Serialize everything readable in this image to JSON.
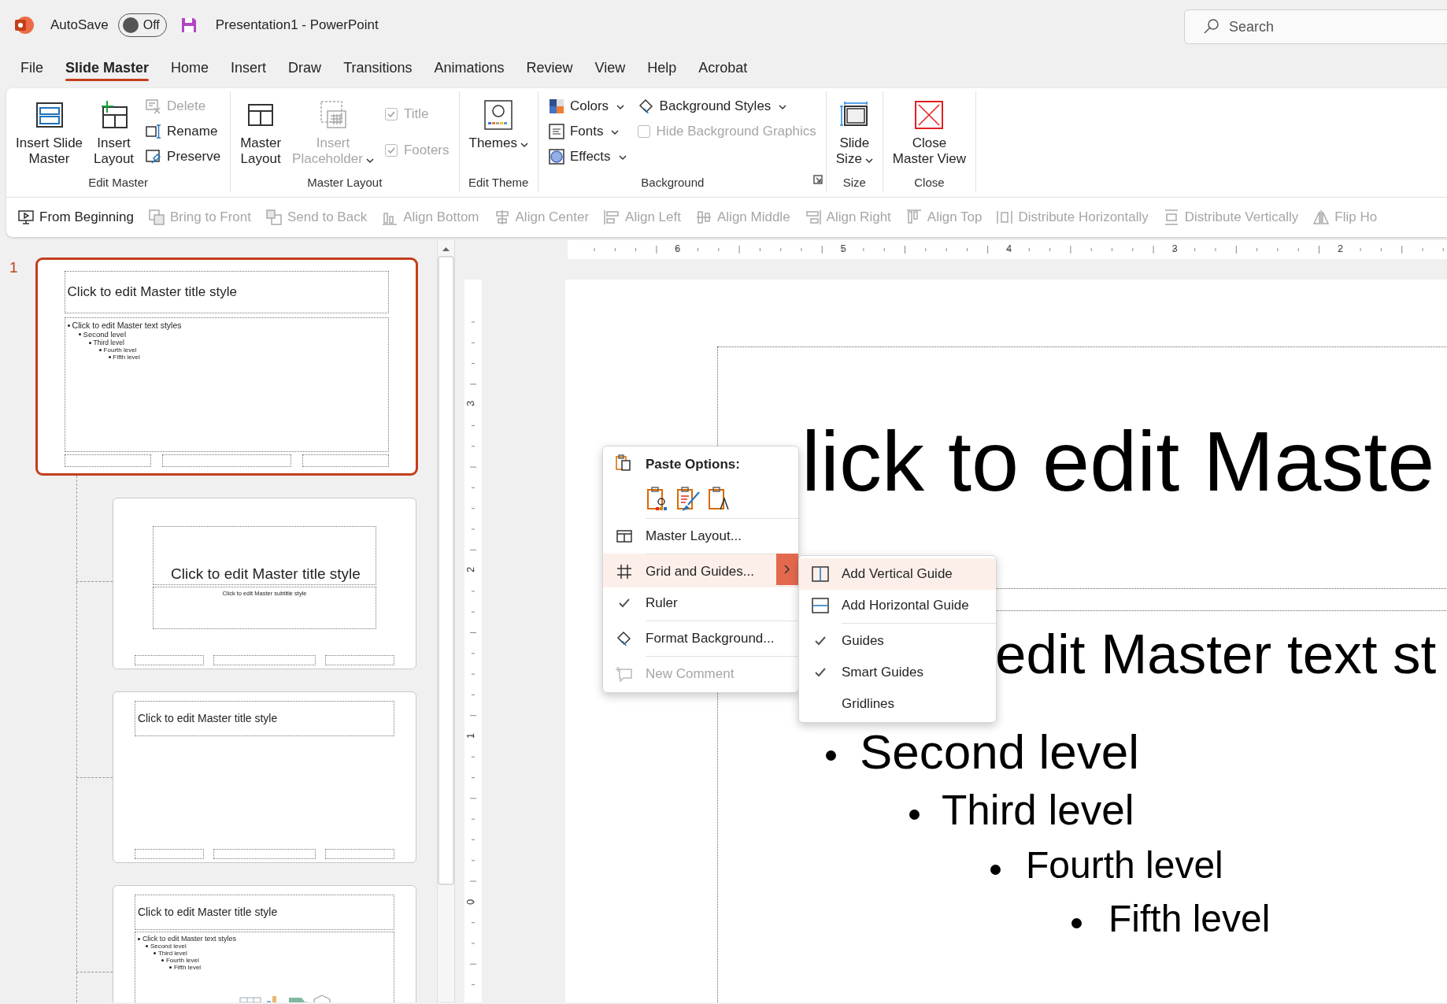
{
  "title_bar": {
    "autosave_label": "AutoSave",
    "autosave_on": false,
    "autosave_state": "Off",
    "document_title": "Presentation1  -  PowerPoint",
    "search": {
      "placeholder": "Search"
    }
  },
  "menu_tabs": [
    {
      "label": "File",
      "selected": false
    },
    {
      "label": "Slide Master",
      "selected": true
    },
    {
      "label": "Home",
      "selected": false
    },
    {
      "label": "Insert",
      "selected": false
    },
    {
      "label": "Draw",
      "selected": false
    },
    {
      "label": "Transitions",
      "selected": false
    },
    {
      "label": "Animations",
      "selected": false
    },
    {
      "label": "Review",
      "selected": false
    },
    {
      "label": "View",
      "selected": false
    },
    {
      "label": "Help",
      "selected": false
    },
    {
      "label": "Acrobat",
      "selected": false
    }
  ],
  "ribbon": {
    "groups": [
      {
        "label": "Edit Master",
        "launcher": false,
        "controls": [
          {
            "kind": "large",
            "label": "Insert Slide\nMaster",
            "disabled": false,
            "dropdown": false
          },
          {
            "kind": "large",
            "label": "Insert\nLayout",
            "disabled": false,
            "dropdown": false
          },
          {
            "kind": "stack",
            "items": [
              {
                "kind": "button",
                "label": "Delete",
                "disabled": true,
                "dropdown": false
              },
              {
                "kind": "button",
                "label": "Rename",
                "disabled": false,
                "dropdown": false
              },
              {
                "kind": "button",
                "label": "Preserve",
                "disabled": false,
                "dropdown": false
              }
            ]
          }
        ]
      },
      {
        "label": "Master Layout",
        "launcher": false,
        "controls": [
          {
            "kind": "large",
            "label": "Master\nLayout",
            "disabled": false,
            "dropdown": false
          },
          {
            "kind": "large",
            "label": "Insert\nPlaceholder",
            "disabled": true,
            "dropdown": true
          },
          {
            "kind": "stack",
            "items": [
              {
                "kind": "checkbox",
                "label": "Title",
                "checked": true,
                "disabled": true
              },
              {
                "kind": "checkbox",
                "label": "Footers",
                "checked": true,
                "disabled": true
              }
            ]
          }
        ]
      },
      {
        "label": "Edit Theme",
        "launcher": false,
        "controls": [
          {
            "kind": "large",
            "label": "Themes",
            "disabled": false,
            "dropdown": true
          }
        ]
      },
      {
        "label": "Background",
        "launcher": true,
        "controls": [
          {
            "kind": "stack",
            "items": [
              {
                "kind": "button",
                "label": "Colors",
                "disabled": false,
                "dropdown": true
              },
              {
                "kind": "button",
                "label": "Fonts",
                "disabled": false,
                "dropdown": true
              },
              {
                "kind": "button",
                "label": "Effects",
                "disabled": false,
                "dropdown": true
              }
            ]
          },
          {
            "kind": "stack",
            "items": [
              {
                "kind": "button",
                "label": "Background Styles",
                "disabled": false,
                "dropdown": true
              },
              {
                "kind": "checkbox",
                "label": "Hide Background Graphics",
                "checked": false,
                "disabled": true
              }
            ]
          }
        ]
      },
      {
        "label": "Size",
        "launcher": false,
        "controls": [
          {
            "kind": "large",
            "label": "Slide\nSize",
            "disabled": false,
            "dropdown": true
          }
        ]
      },
      {
        "label": "Close",
        "launcher": false,
        "controls": [
          {
            "kind": "large",
            "label": "Close\nMaster View",
            "disabled": false,
            "dropdown": false
          }
        ]
      }
    ]
  },
  "toolbar": [
    {
      "label": "From Beginning",
      "disabled": false
    },
    {
      "label": "Bring to Front",
      "disabled": true
    },
    {
      "label": "Send to Back",
      "disabled": true
    },
    {
      "label": "Align Bottom",
      "disabled": true
    },
    {
      "label": "Align Center",
      "disabled": true
    },
    {
      "label": "Align Left",
      "disabled": true
    },
    {
      "label": "Align Middle",
      "disabled": true
    },
    {
      "label": "Align Right",
      "disabled": true
    },
    {
      "label": "Align Top",
      "disabled": true
    },
    {
      "label": "Distribute Horizontally",
      "disabled": true
    },
    {
      "label": "Distribute Vertically",
      "disabled": true
    },
    {
      "label": "Flip Ho",
      "disabled": true
    }
  ],
  "slides": [
    {
      "number": "1",
      "selected": true,
      "kind": "master",
      "title": "Click to edit Master title style",
      "body": [
        {
          "text": "Click to edit Master text styles",
          "children": [
            {
              "text": "Second level",
              "children": [
                {
                  "text": "Third level",
                  "children": [
                    {
                      "text": "Fourth level",
                      "children": [
                        {
                          "text": "Fifth level"
                        }
                      ]
                    }
                  ]
                }
              ]
            }
          ]
        }
      ]
    },
    {
      "selected": false,
      "kind": "title",
      "title": "Click to edit Master title style",
      "subtitle": "Click to edit Master subtitle style"
    },
    {
      "selected": false,
      "kind": "title_only",
      "title": "Click to edit Master title style"
    },
    {
      "selected": false,
      "kind": "content",
      "title": "Click to edit Master title style",
      "body": [
        {
          "text": "Click to edit Master text styles",
          "children": [
            {
              "text": "Second level",
              "children": [
                {
                  "text": "Third level",
                  "children": [
                    {
                      "text": "Fourth level",
                      "children": [
                        {
                          "text": "Fifth level"
                        }
                      ]
                    }
                  ]
                }
              ]
            }
          ]
        }
      ]
    }
  ],
  "horizontal_ruler": {
    "labels": [
      "6",
      "5",
      "4",
      "3",
      "2"
    ]
  },
  "vertical_ruler": {
    "labels": [
      "3",
      "2",
      "1",
      "0"
    ]
  },
  "slide_editor": {
    "title": "lick to edit Maste",
    "body": [
      {
        "text": "edit Master text st",
        "children": [
          {
            "text": "Second level",
            "children": [
              {
                "text": "Third level",
                "children": [
                  {
                    "text": "Fourth level",
                    "children": [
                      {
                        "text": "Fifth level"
                      }
                    ]
                  }
                ]
              }
            ]
          }
        ]
      }
    ]
  },
  "context_menu": {
    "paste_label": "Paste Options:",
    "items": [
      {
        "label": "Master Layout...",
        "selected": false,
        "checked": false,
        "disabled": false,
        "submenu": false,
        "divider": true
      },
      {
        "label": "Grid and Guides...",
        "selected": true,
        "checked": false,
        "disabled": false,
        "submenu": true,
        "divider": true
      },
      {
        "label": "Ruler",
        "selected": false,
        "checked": true,
        "disabled": false,
        "submenu": false,
        "divider": false
      },
      {
        "label": "Format Background...",
        "selected": false,
        "checked": false,
        "disabled": false,
        "submenu": false,
        "divider": true
      },
      {
        "label": "New Comment",
        "selected": false,
        "checked": false,
        "disabled": true,
        "submenu": false,
        "divider": true
      }
    ]
  },
  "submenu": {
    "items": [
      {
        "label": "Add Vertical Guide",
        "selected": true,
        "checked": false,
        "divider": false
      },
      {
        "label": "Add Horizontal Guide",
        "selected": false,
        "checked": false,
        "divider": false
      },
      {
        "label": "Guides",
        "selected": false,
        "checked": true,
        "divider": true
      },
      {
        "label": "Smart Guides",
        "selected": false,
        "checked": true,
        "divider": false
      },
      {
        "label": "Gridlines",
        "selected": false,
        "checked": false,
        "divider": false
      }
    ]
  }
}
